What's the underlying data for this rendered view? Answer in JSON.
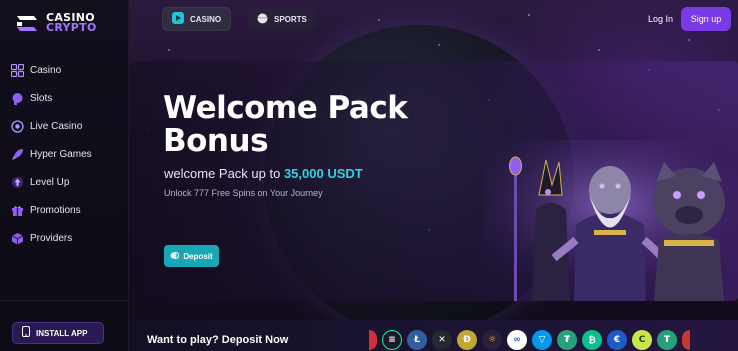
{
  "brand": {
    "line1": "CASINO",
    "line2": "CRYPTO",
    "accent": "#a774ff"
  },
  "sidebar": {
    "items": [
      {
        "label": "Casino",
        "icon": "grid-icon"
      },
      {
        "label": "Slots",
        "icon": "chat-bubble-icon"
      },
      {
        "label": "Live Casino",
        "icon": "live-icon"
      },
      {
        "label": "Hyper Games",
        "icon": "rocket-icon"
      },
      {
        "label": "Level Up",
        "icon": "level-up-icon"
      },
      {
        "label": "Promotions",
        "icon": "gift-icon"
      },
      {
        "label": "Providers",
        "icon": "cube-icon"
      }
    ],
    "install_label": "INSTALL APP"
  },
  "topbar": {
    "casino_label": "CASINO",
    "sports_label": "SPORTS",
    "login_label": "Log In",
    "signup_label": "Sign up",
    "signup_color": "#7a3be6"
  },
  "hero": {
    "title": "Welcome Pack Bonus",
    "subtitle_prefix": "welcome Pack up to ",
    "subtitle_highlight": "35,000 USDT",
    "description": "Unlock 777 Free Spins on Your Journey",
    "deposit_label": "Deposit",
    "highlight_color": "#2fd4e6"
  },
  "bottom": {
    "prompt": "Want to play? Deposit Now",
    "coins": [
      "tron-icon",
      "solana-icon",
      "litecoin-icon",
      "xrp-icon",
      "dogecoin-icon",
      "sun-icon",
      "chainlink-icon",
      "ton-icon",
      "usdt-tron-icon",
      "bitcoin-cash-icon",
      "euro-icon",
      "celo-icon",
      "tether-icon",
      "red-coin-icon"
    ]
  }
}
